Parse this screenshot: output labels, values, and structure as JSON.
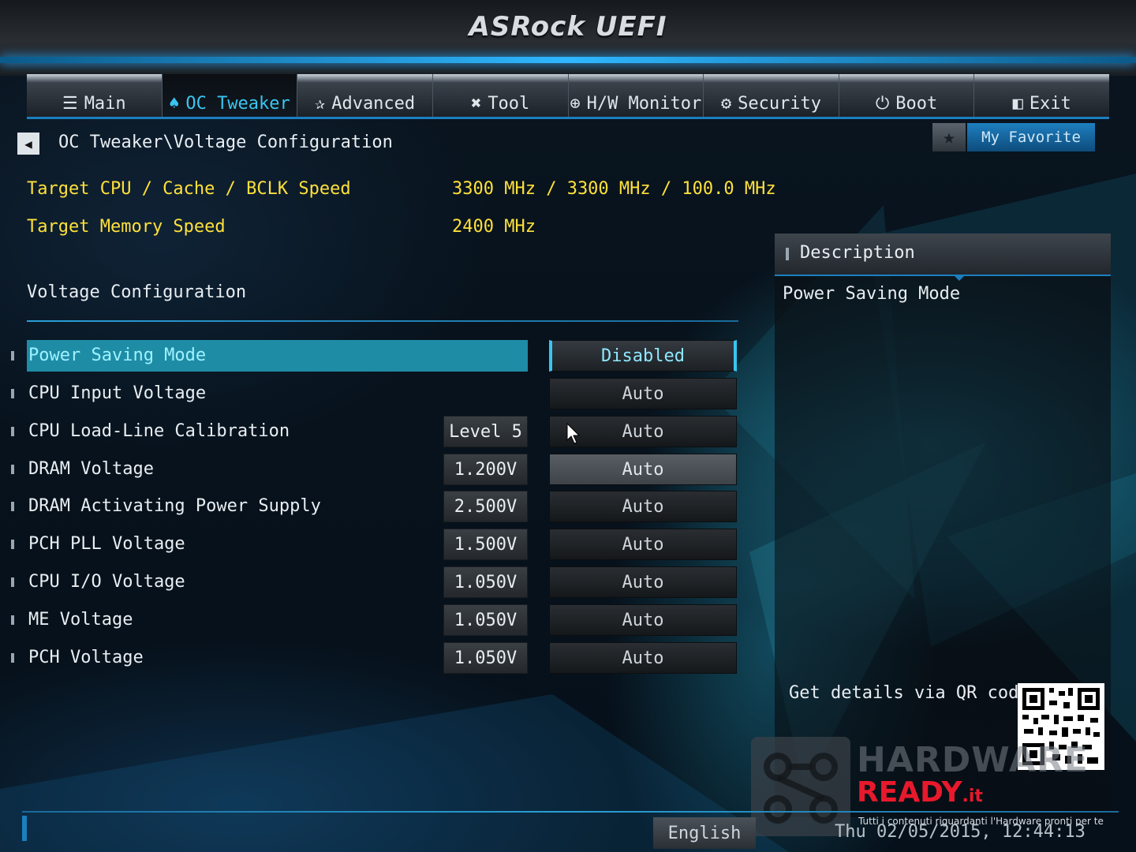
{
  "app": {
    "logo": "ASRock UEFI"
  },
  "tabs": [
    {
      "label": "Main",
      "icon": "list-icon",
      "glyph": "☰",
      "active": false
    },
    {
      "label": "OC Tweaker",
      "icon": "rocket-icon",
      "glyph": "♠",
      "active": true
    },
    {
      "label": "Advanced",
      "icon": "star-icon",
      "glyph": "✰",
      "active": false
    },
    {
      "label": "Tool",
      "icon": "tools-icon",
      "glyph": "✖",
      "active": false
    },
    {
      "label": "H/W Monitor",
      "icon": "monitor-icon",
      "glyph": "⊕",
      "active": false
    },
    {
      "label": "Security",
      "icon": "shield-icon",
      "glyph": "⚙",
      "active": false
    },
    {
      "label": "Boot",
      "icon": "power-icon",
      "glyph": "⏻",
      "active": false
    },
    {
      "label": "Exit",
      "icon": "exit-icon",
      "glyph": "◧",
      "active": false
    }
  ],
  "breadcrumb": "OC Tweaker\\Voltage Configuration",
  "favorite": {
    "label": "My Favorite",
    "star": "★"
  },
  "info": [
    {
      "label": "Target CPU / Cache / BCLK Speed",
      "value": "3300 MHz / 3300 MHz / 100.0 MHz"
    },
    {
      "label": "Target Memory Speed",
      "value": "2400 MHz"
    }
  ],
  "section_title": "Voltage Configuration",
  "settings": [
    {
      "label": "Power Saving Mode",
      "current": "",
      "option": "Disabled",
      "state": "selected"
    },
    {
      "label": "CPU Input Voltage",
      "current": "",
      "option": "Auto",
      "state": ""
    },
    {
      "label": "CPU Load-Line Calibration",
      "current": "Level 5",
      "option": "Auto",
      "state": ""
    },
    {
      "label": "DRAM Voltage",
      "current": "1.200V",
      "option": "Auto",
      "state": "hover"
    },
    {
      "label": "DRAM Activating Power Supply",
      "current": "2.500V",
      "option": "Auto",
      "state": ""
    },
    {
      "label": "PCH PLL Voltage",
      "current": "1.500V",
      "option": "Auto",
      "state": ""
    },
    {
      "label": "CPU I/O Voltage",
      "current": "1.050V",
      "option": "Auto",
      "state": ""
    },
    {
      "label": "ME Voltage",
      "current": "1.050V",
      "option": "Auto",
      "state": ""
    },
    {
      "label": "PCH Voltage",
      "current": "1.050V",
      "option": "Auto",
      "state": ""
    }
  ],
  "description": {
    "title": "Description",
    "text": "Power Saving Mode",
    "qr_label": "Get details via QR code"
  },
  "watermark": {
    "hardware": "HARDWARE",
    "ready": "READY",
    "suffix": ".it",
    "tagline": "Tutti i contenuti riguardanti l'Hardware pronti per te"
  },
  "footer": {
    "language": "English",
    "datetime": "Thu 02/05/2015, 12:44:13"
  },
  "colors": {
    "accent": "#38c6f0",
    "highlight": "#1f8ca6",
    "info_text": "#ffe03a",
    "brand_red": "#e8192c"
  }
}
